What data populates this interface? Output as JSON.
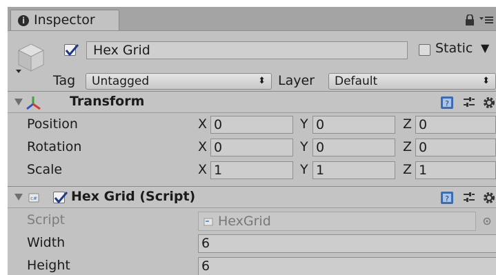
{
  "tab": {
    "title": "Inspector",
    "icon": "info-icon"
  },
  "window_controls": [
    "lock-icon",
    "context-menu-icon"
  ],
  "game_object": {
    "active": true,
    "name": "Hex Grid",
    "static_checked": false,
    "static_label": "Static",
    "tag_label": "Tag",
    "tag_value": "Untagged",
    "layer_label": "Layer",
    "layer_value": "Default"
  },
  "transform": {
    "title": "Transform",
    "expanded": true,
    "rows": [
      {
        "label": "Position",
        "x": "0",
        "y": "0",
        "z": "0"
      },
      {
        "label": "Rotation",
        "x": "0",
        "y": "0",
        "z": "0"
      },
      {
        "label": "Scale",
        "x": "1",
        "y": "1",
        "z": "1"
      }
    ],
    "axis_labels": {
      "x": "X",
      "y": "Y",
      "z": "Z"
    }
  },
  "script_component": {
    "title": "Hex Grid (Script)",
    "enabled": true,
    "expanded": true,
    "script_label": "Script",
    "script_value": "HexGrid",
    "fields": [
      {
        "label": "Width",
        "value": "6"
      },
      {
        "label": "Height",
        "value": "6"
      }
    ]
  },
  "colors": {
    "panel_bg": "#c2c2c2",
    "tab_bar_bg": "#a4a4a4",
    "field_bg": "#cdcdcd",
    "checkmark": "#1e3a8a",
    "help_icon": "#3c6cb4"
  }
}
